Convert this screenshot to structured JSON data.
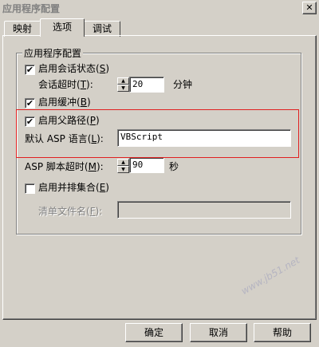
{
  "window": {
    "title": "应用程序配置",
    "close_glyph": "✕"
  },
  "tabs": [
    {
      "label": "映射",
      "active": false
    },
    {
      "label": "选项",
      "active": true
    },
    {
      "label": "调试",
      "active": false
    }
  ],
  "group": {
    "title": "应用程序配置",
    "enable_session_state": {
      "label": "启用会话状态",
      "key": "S",
      "checked": true
    },
    "session_timeout": {
      "label": "会话超时",
      "key": "T",
      "value": "20",
      "unit": "分钟"
    },
    "enable_buffering": {
      "label": "启用缓冲",
      "key": "B",
      "checked": true
    },
    "enable_parent_paths": {
      "label": "启用父路径",
      "key": "P",
      "checked": true
    },
    "default_asp_language": {
      "label": "默认 ASP 语言",
      "key": "L",
      "value": "VBScript"
    },
    "asp_script_timeout": {
      "label": "ASP 脚本超时",
      "key": "M",
      "value": "90",
      "unit": "秒"
    },
    "enable_side_by_side": {
      "label": "启用并排集合",
      "key": "E",
      "checked": false
    },
    "manifest_file_name": {
      "label": "清单文件名",
      "key": "F",
      "value": ""
    }
  },
  "buttons": {
    "ok": "确定",
    "cancel": "取消",
    "help": "帮助"
  },
  "watermark": "www.jb51.net",
  "colors": {
    "highlight_box": "#e02020",
    "face": "#d4d0c8"
  }
}
